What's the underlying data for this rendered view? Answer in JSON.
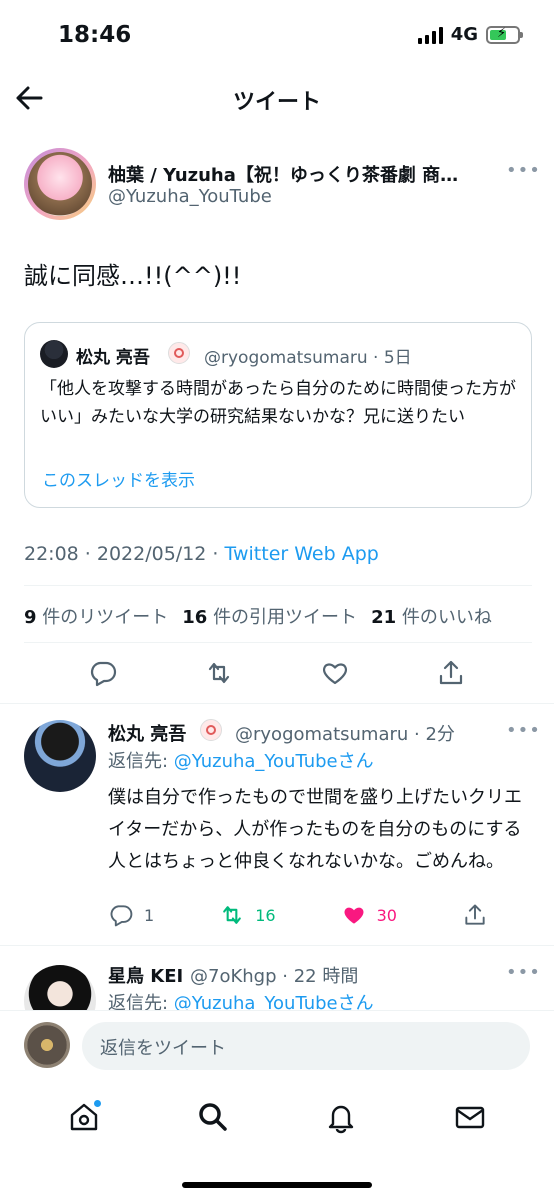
{
  "status": {
    "time": "18:46",
    "network": "4G"
  },
  "header": {
    "title": "ツイート"
  },
  "tweet": {
    "author_name": "柚葉 / Yuzuha【祝！ゆっくり茶番劇 商…",
    "author_handle": "@Yuzuha_YouTube",
    "text": "誠に同感…!!(^^)!!",
    "timestamp": "22:08 · 2022/05/12 · ",
    "source": "Twitter Web App"
  },
  "quoted": {
    "author_name": "松丸 亮吾",
    "meta": "@ryogomatsumaru · 5日",
    "text": "「他人を攻撃する時間があったら自分のために時間使った方がいい」みたいな大学の研究結果ないかな？兄に送りたい",
    "link": "このスレッドを表示"
  },
  "stats": [
    {
      "count": "9",
      "label": "件のリツイート"
    },
    {
      "count": "16",
      "label": "件の引用ツイート"
    },
    {
      "count": "21",
      "label": "件のいいね"
    }
  ],
  "replies": [
    {
      "author_name": "松丸 亮吾",
      "meta": "@ryogomatsumaru · 2分",
      "reply_to_prefix": "返信先: ",
      "reply_to_handle": "@Yuzuha_YouTube",
      "reply_to_suffix": "さん",
      "text": "僕は自分で作ったもので世間を盛り上げたいクリエイターだから、人が作ったものを自分のものにする人とはちょっと仲良くなれないかな。ごめんね。",
      "replies": "1",
      "retweets": "16",
      "likes": "30"
    },
    {
      "author_name": "星鳥 KEI",
      "meta": "@7oKhgp · 22 時間",
      "reply_to_prefix": "返信先: ",
      "reply_to_handle": "@Yuzuha_YouTube",
      "reply_to_suffix": "さん"
    }
  ],
  "compose": {
    "placeholder": "返信をツイート"
  },
  "colors": {
    "accent": "#1d9bf0",
    "retweet": "#00ba7c",
    "like": "#f91880"
  },
  "icons": [
    "back-arrow-icon",
    "reply-icon",
    "retweet-icon",
    "like-icon",
    "share-icon",
    "home-icon",
    "search-icon",
    "notifications-icon",
    "messages-icon"
  ]
}
